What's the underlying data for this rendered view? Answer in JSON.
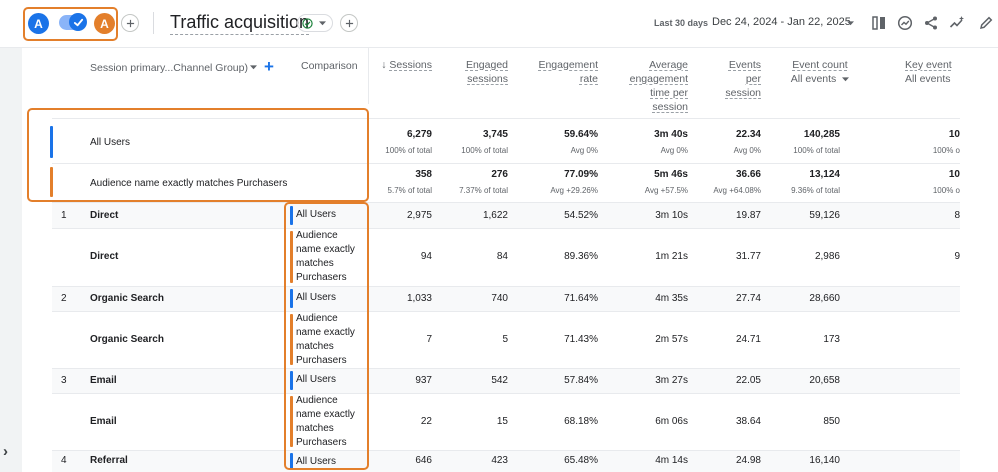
{
  "header": {
    "avatar_a": "A",
    "avatar_b": "A",
    "title": "Traffic acquisition",
    "date_label": "Last 30 days",
    "date_range": "Dec 24, 2024 - Jan 22, 2025",
    "colors": {
      "blue": "#1a73e8",
      "orange": "#e37f2b",
      "accent": "#1a73e8"
    }
  },
  "table": {
    "dimension_header": "Session primary...Channel Group)",
    "dimension_add": "+",
    "comparison_header": "Comparison",
    "columns": [
      {
        "lines": [
          "Sessions"
        ],
        "sort": "↓"
      },
      {
        "lines": [
          "Engaged",
          "sessions"
        ]
      },
      {
        "lines": [
          "Engagement",
          "rate"
        ]
      },
      {
        "lines": [
          "Average",
          "engagement",
          "time per",
          "session"
        ]
      },
      {
        "lines": [
          "Events",
          "per",
          "session"
        ]
      },
      {
        "lines": [
          "Event count",
          "All events"
        ]
      },
      {
        "lines": [
          "Key event",
          "All events"
        ]
      }
    ],
    "totals": [
      {
        "label": "All Users",
        "values": [
          "6,279",
          "3,745",
          "59.64%",
          "3m 40s",
          "22.34",
          "140,285",
          "10"
        ],
        "subs": [
          "100% of total",
          "100% of total",
          "Avg 0%",
          "Avg 0%",
          "Avg 0%",
          "100% of total",
          "100% o"
        ]
      },
      {
        "label": "Audience name exactly matches Purchasers",
        "values": [
          "358",
          "276",
          "77.09%",
          "5m 46s",
          "36.66",
          "13,124",
          "10"
        ],
        "subs": [
          "5.7% of total",
          "7.37% of total",
          "Avg +29.26%",
          "Avg +57.5%",
          "Avg +64.08%",
          "9.36% of total",
          "100% o"
        ]
      }
    ],
    "rows": [
      {
        "num": "1",
        "channel": "Direct",
        "comparison": "All Users",
        "values": [
          "2,975",
          "1,622",
          "54.52%",
          "3m 10s",
          "19.87",
          "59,126",
          "8"
        ]
      },
      {
        "num": "",
        "channel": "Direct",
        "comparison": "Audience name exactly matches Purchasers",
        "values": [
          "94",
          "84",
          "89.36%",
          "1m 21s",
          "31.77",
          "2,986",
          "9"
        ]
      },
      {
        "num": "2",
        "channel": "Organic Search",
        "comparison": "All Users",
        "values": [
          "1,033",
          "740",
          "71.64%",
          "4m 35s",
          "27.74",
          "28,660",
          ""
        ]
      },
      {
        "num": "",
        "channel": "Organic Search",
        "comparison": "Audience name exactly matches Purchasers",
        "values": [
          "7",
          "5",
          "71.43%",
          "2m 57s",
          "24.71",
          "173",
          ""
        ]
      },
      {
        "num": "3",
        "channel": "Email",
        "comparison": "All Users",
        "values": [
          "937",
          "542",
          "57.84%",
          "3m 27s",
          "22.05",
          "20,658",
          ""
        ]
      },
      {
        "num": "",
        "channel": "Email",
        "comparison": "Audience name exactly matches Purchasers",
        "values": [
          "22",
          "15",
          "68.18%",
          "6m 06s",
          "38.64",
          "850",
          ""
        ]
      },
      {
        "num": "4",
        "channel": "Referral",
        "comparison": "All Users",
        "values": [
          "646",
          "423",
          "65.48%",
          "4m 14s",
          "24.98",
          "16,140",
          ""
        ]
      }
    ]
  }
}
